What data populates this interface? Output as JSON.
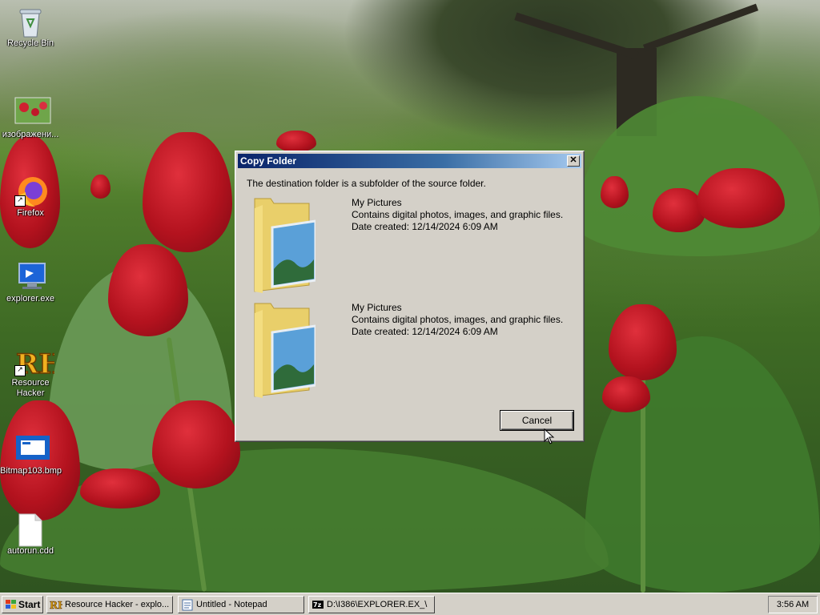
{
  "desktop": {
    "icons": [
      {
        "label": "Recycle Bin",
        "icon": "recycle-bin-icon"
      },
      {
        "label": "изображени...",
        "icon": "image-file-icon"
      },
      {
        "label": "Firefox",
        "icon": "firefox-icon"
      },
      {
        "label": "explorer.exe",
        "icon": "explorer-exe-icon"
      },
      {
        "label": "Resource Hacker",
        "icon": "resource-hacker-icon"
      },
      {
        "label": "Bitmap103.bmp",
        "icon": "bitmap-file-icon"
      },
      {
        "label": "autorun.cdd",
        "icon": "blank-file-icon"
      }
    ]
  },
  "dialog": {
    "title": "Copy Folder",
    "close_glyph": "✕",
    "message": "The destination folder is a subfolder of the source folder.",
    "folders": [
      {
        "name": "My Pictures",
        "description": "Contains digital photos, images, and graphic files.",
        "date_created": "Date created: 12/14/2024 6:09 AM"
      },
      {
        "name": "My Pictures",
        "description": "Contains digital photos, images, and graphic files.",
        "date_created": "Date created: 12/14/2024 6:09 AM"
      }
    ],
    "cancel_label": "Cancel"
  },
  "taskbar": {
    "start_label": "Start",
    "tasks": [
      {
        "label": "Resource Hacker - explo...",
        "icon": "resource-hacker-icon"
      },
      {
        "label": "Untitled - Notepad",
        "icon": "notepad-icon"
      },
      {
        "label": "D:\\I386\\EXPLORER.EX_\\",
        "icon": "7zip-icon"
      }
    ],
    "clock": "3:56 AM"
  },
  "colors": {
    "titlebar_start": "#0a246a",
    "titlebar_end": "#a6caf0",
    "dialog_face": "#d4d0c8"
  }
}
